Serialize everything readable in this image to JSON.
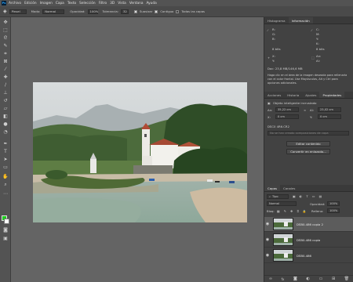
{
  "menu": [
    "Archivo",
    "Edición",
    "Imagen",
    "Capa",
    "Texto",
    "Selección",
    "Filtro",
    "3D",
    "Vista",
    "Ventana",
    "Ayuda"
  ],
  "app_logo": "Ps",
  "options": {
    "preset": "Pinsel",
    "mode_label": "Modo:",
    "mode_value": "Normal",
    "opacity_label": "Opacidad:",
    "opacity_value": "100%",
    "tolerance_label": "Tolerancia:",
    "tolerance_value": "32",
    "antialias_label": "Suavizar",
    "contiguous_label": "Contiguo",
    "all_layers_label": "Todas las capas"
  },
  "tools": [
    "move-icon",
    "marquee-icon",
    "lasso-icon",
    "quick-select-icon",
    "crop-icon",
    "frame-icon",
    "eyedropper-icon",
    "healing-icon",
    "brush-icon",
    "stamp-icon",
    "history-brush-icon",
    "eraser-icon",
    "gradient-icon",
    "blur-icon",
    "dodge-icon",
    "pen-icon",
    "type-icon",
    "path-select-icon",
    "shape-icon",
    "hand-icon",
    "zoom-icon",
    "more-icon",
    "mask-icon",
    "screen-mode-icon"
  ],
  "colors": {
    "foreground": "#1fd01f",
    "background": "#ffffff",
    "panel": "#424242",
    "selected_layer": "#5c5c5c"
  },
  "info_panel": {
    "tabs": [
      "Histograma",
      "Información"
    ],
    "r_label": "R:",
    "g_label": "G:",
    "b_label": "B:",
    "c_label": "C:",
    "m_label": "M:",
    "y_label": "Y:",
    "k_label": "K:",
    "bits_left": "8 bits",
    "bits_right": "8 bits",
    "x_label": "X:",
    "y_coord_label": "Y:",
    "w_label": "An:",
    "h_label": "Al:",
    "doc_info": "Doc: 23,8 MB/146,6 MB",
    "hint": "Haga clic en el área de la imagen deseada para rellenarla con el color frontal. Use Mayúsculas, Alt y Ctrl para opciones adicionales."
  },
  "properties_panel": {
    "tabs": [
      "Acciones",
      "Historia",
      "Ajustes",
      "Propiedades"
    ],
    "object_label": "Objeto inteligente incrustado",
    "an_label": "An:",
    "an_value": "35,22 cm",
    "al_label": "Al:",
    "al_value": "23,02 cm",
    "x_label": "X:",
    "x_value": "0 cm",
    "y_label": "Y:",
    "y_value": "0 cm",
    "file_name": "DSC0 4R6.CR2",
    "no_layer_comps": "No se han creado composiciones de capa",
    "edit_button": "Editar contenido",
    "convert_button": "Convertir en enlazado..."
  },
  "layers_panel": {
    "tabs": [
      "Capas",
      "Canales"
    ],
    "filter_label": "Tipo",
    "blend_mode": "Normal",
    "opacity_label": "Opacidad:",
    "opacity_value": "100%",
    "lock_label": "Bloq:",
    "fill_label": "Relleno:",
    "fill_value": "100%",
    "layers": [
      {
        "name": "DSB0-486 copia 2",
        "selected": true
      },
      {
        "name": "DSB0-486 copia",
        "selected": false
      },
      {
        "name": "DSB0-486",
        "selected": false
      }
    ],
    "bottom_icons": [
      "link-icon",
      "fx-icon",
      "mask-icon",
      "adjustment-icon",
      "group-icon",
      "new-layer-icon",
      "trash-icon"
    ]
  }
}
